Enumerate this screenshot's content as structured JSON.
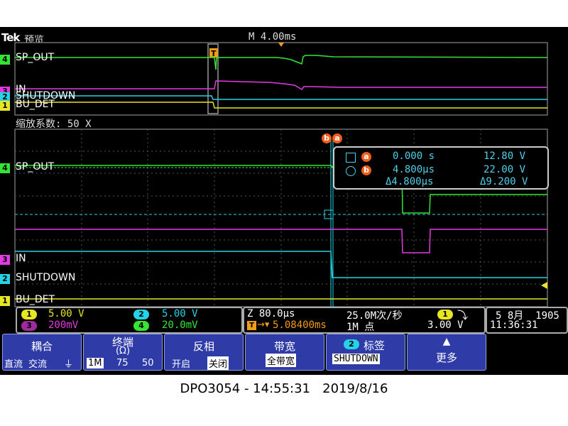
{
  "header": {
    "brand": "Tek",
    "mode": "预览",
    "timebase": "M 4.00ms"
  },
  "overview": {
    "channels": [
      {
        "num": "4",
        "name": "SP_OUT",
        "color": "#34e634"
      },
      {
        "num": "3",
        "name": "IN",
        "color": "#e23be2"
      },
      {
        "num": "2",
        "name": "SHUTDOWN",
        "color": "#23d3e6"
      },
      {
        "num": "1",
        "name": "BU_DET",
        "color": "#e6e622"
      }
    ],
    "trigger_marker": "T"
  },
  "zoom": {
    "label": "缩放系数: 50 X"
  },
  "main": {
    "channels": [
      {
        "num": "4",
        "name": "SP_OUT"
      },
      {
        "num": "3",
        "name": "IN"
      },
      {
        "num": "2",
        "name": "SHUTDOWN"
      },
      {
        "num": "1",
        "name": "BU_DET"
      }
    ],
    "cursor_marks": [
      "b",
      "a"
    ]
  },
  "cursors": {
    "a": {
      "label": "a",
      "time": "0.000 s",
      "volt": "12.80 V"
    },
    "b": {
      "label": "b",
      "time": "4.800µs",
      "volt": "22.00 V"
    },
    "delta": {
      "time": "Δ4.800µs",
      "volt": "Δ9.200 V"
    }
  },
  "status": {
    "ch_scales": [
      {
        "num": "1",
        "value": "5.00 V",
        "color": "#e6e622"
      },
      {
        "num": "2",
        "value": "5.00 V",
        "color": "#23d3e6"
      },
      {
        "num": "3",
        "value": "200mV",
        "color": "#e23be2"
      },
      {
        "num": "4",
        "value": "20.0mV",
        "color": "#34e634"
      }
    ],
    "zoom_time": "Z 80.0µs",
    "sample_rate": "25.0M次/秒",
    "trigger_pos": "5.08400ms",
    "record_length": "1M 点",
    "trigger_ch": "1",
    "trigger_slope": "⤵",
    "trigger_level": "3.00 V",
    "date": "5 8月  1905",
    "time": "11:36:31"
  },
  "menu": [
    {
      "title": "耦合",
      "opts": [
        "直流",
        "交流",
        "⏚"
      ]
    },
    {
      "title": "终端",
      "title2": "(Ω)",
      "opts": [
        "1M",
        "75",
        "50"
      ]
    },
    {
      "title": "反相",
      "opts": [
        "开启",
        "关闭"
      ]
    },
    {
      "title": "带宽",
      "value": "全带宽"
    },
    {
      "title": "标签",
      "badge": "2",
      "value": "SHUTDOWN"
    },
    {
      "title": "更多",
      "arrow": "▲"
    }
  ],
  "caption": "DPO3054 - 14:55:31   2019/8/16"
}
